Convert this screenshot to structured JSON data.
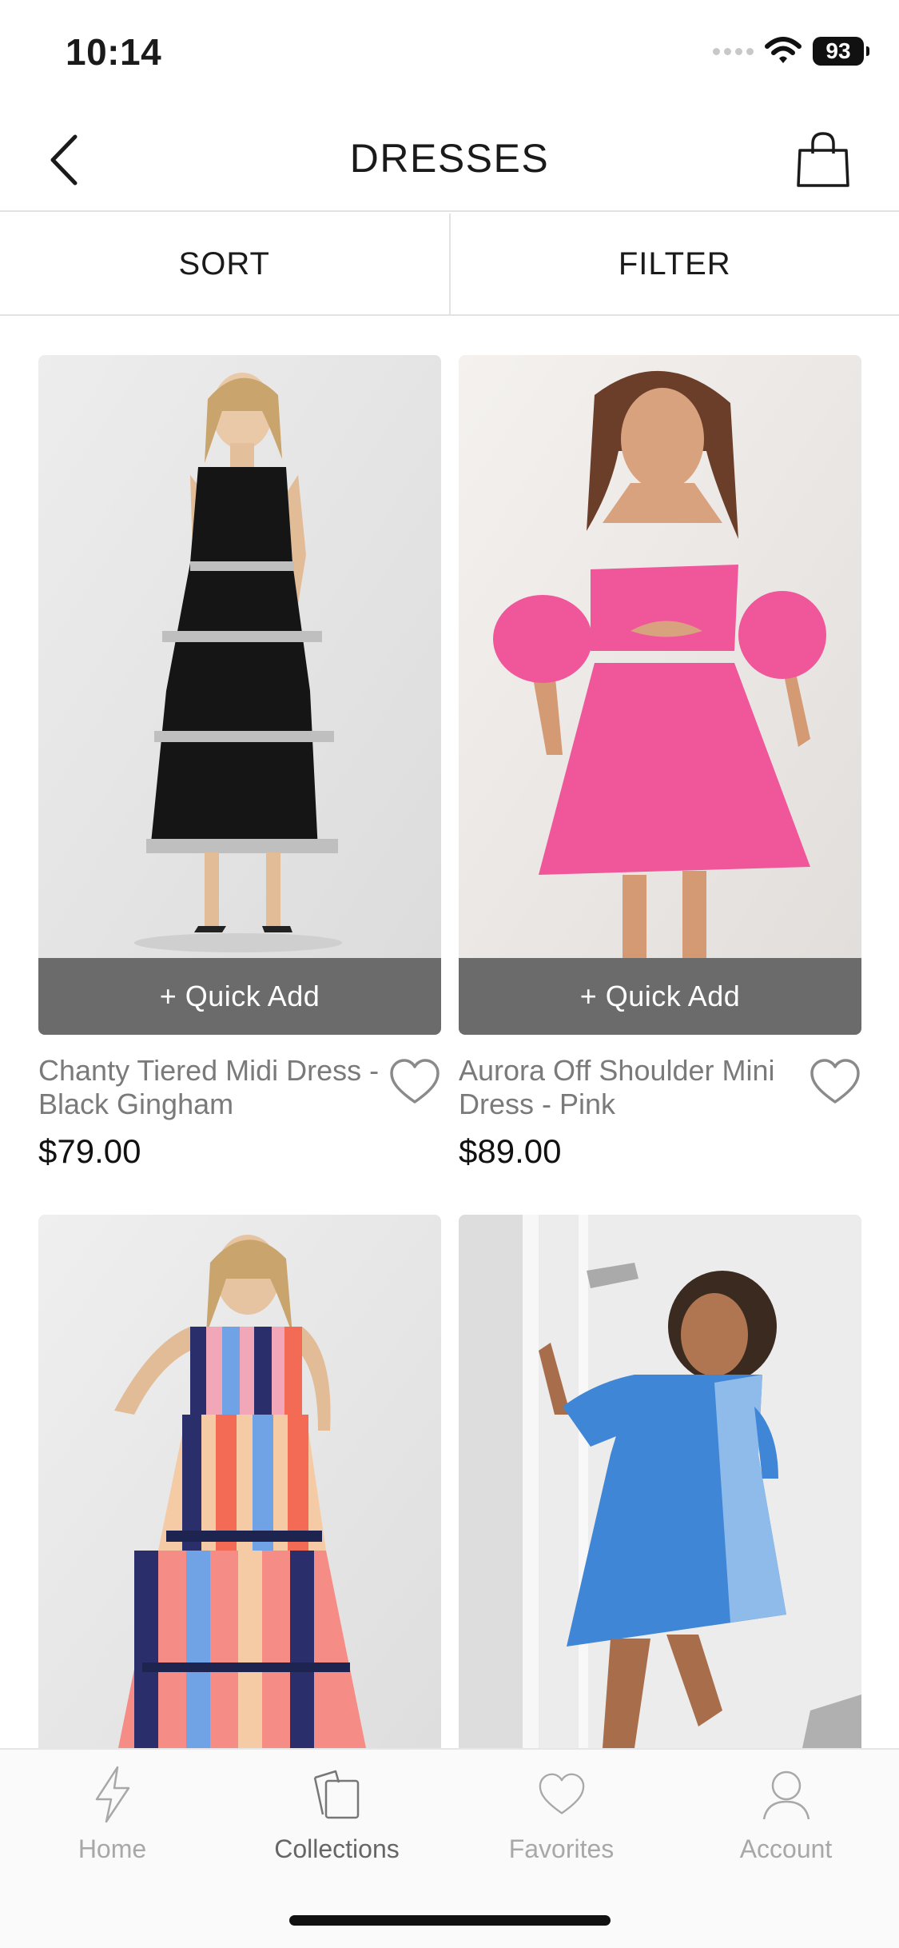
{
  "status_bar": {
    "time": "10:14",
    "battery": "93",
    "icons": [
      "signal-icon",
      "wifi-icon",
      "battery-icon"
    ]
  },
  "header": {
    "title": "DRESSES",
    "back_icon": "chevron-left-icon",
    "cart_icon": "shopping-bag-icon"
  },
  "toolbar": {
    "sort_label": "SORT",
    "filter_label": "FILTER"
  },
  "products": [
    {
      "name": "Chanty Tiered Midi Dress - Black Gingham",
      "price": "$79.00",
      "quick_add_label": "+ Quick Add",
      "favorite_icon": "heart-outline-icon"
    },
    {
      "name": "Aurora Off Shoulder Mini Dress - Pink",
      "price": "$89.00",
      "quick_add_label": "+ Quick Add",
      "favorite_icon": "heart-outline-icon"
    },
    {
      "name": "",
      "price": ""
    },
    {
      "name": "",
      "price": ""
    }
  ],
  "tabbar": {
    "items": [
      {
        "label": "Home",
        "icon": "lightning-icon",
        "active": false
      },
      {
        "label": "Collections",
        "icon": "collections-icon",
        "active": true
      },
      {
        "label": "Favorites",
        "icon": "heart-icon",
        "active": false
      },
      {
        "label": "Account",
        "icon": "user-icon",
        "active": false
      }
    ]
  },
  "colors": {
    "quick_add_bg": "#6b6b6b",
    "pink_dress": "#f0569a",
    "blue_dress": "#3f86d6",
    "black_dress": "#151515"
  }
}
